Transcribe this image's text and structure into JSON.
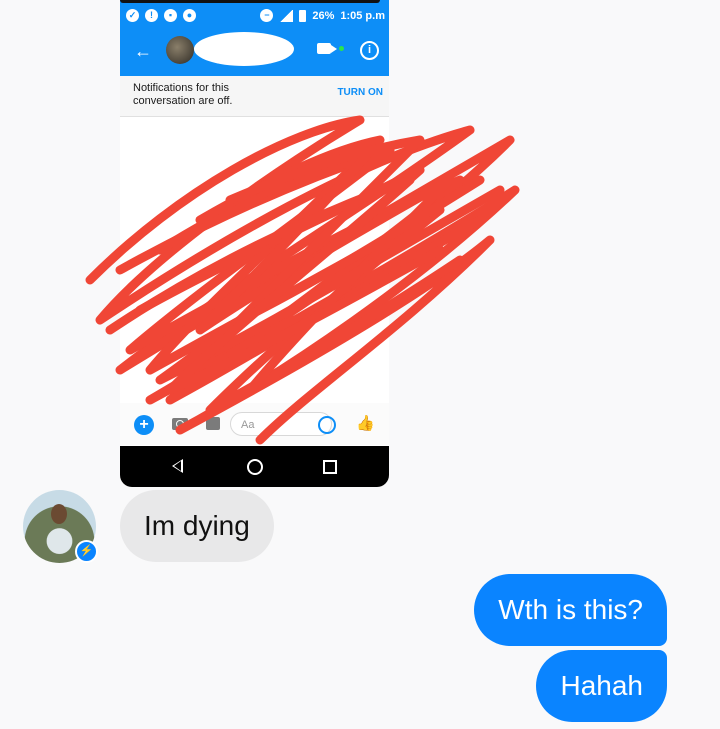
{
  "shared_screenshot": {
    "status_bar": {
      "battery_text": "26%",
      "time_text": "1:05 p.m"
    },
    "header": {
      "back_icon": "arrow-left-icon",
      "video_icon": "video-camera-icon",
      "info_icon": "info-icon"
    },
    "notice": {
      "text": "Notifications for this conversation are off.",
      "action_label": "TURN ON"
    },
    "composer": {
      "placeholder": "Aa",
      "icons": [
        "plus-icon",
        "camera-icon",
        "gallery-icon",
        "emoji-icon",
        "like-icon"
      ]
    },
    "nav_icons": [
      "nav-back-icon",
      "nav-home-icon",
      "nav-recent-icon"
    ],
    "scribble_color": "#f04636"
  },
  "thread": {
    "messages": [
      {
        "direction": "received",
        "text": "Im dying"
      },
      {
        "direction": "sent",
        "text": "Wth is this?"
      },
      {
        "direction": "sent",
        "text": "Hahah"
      }
    ]
  },
  "colors": {
    "accent": "#0a84ff",
    "received_bubble": "#e8e8e9",
    "background": "#f9f9fa"
  }
}
